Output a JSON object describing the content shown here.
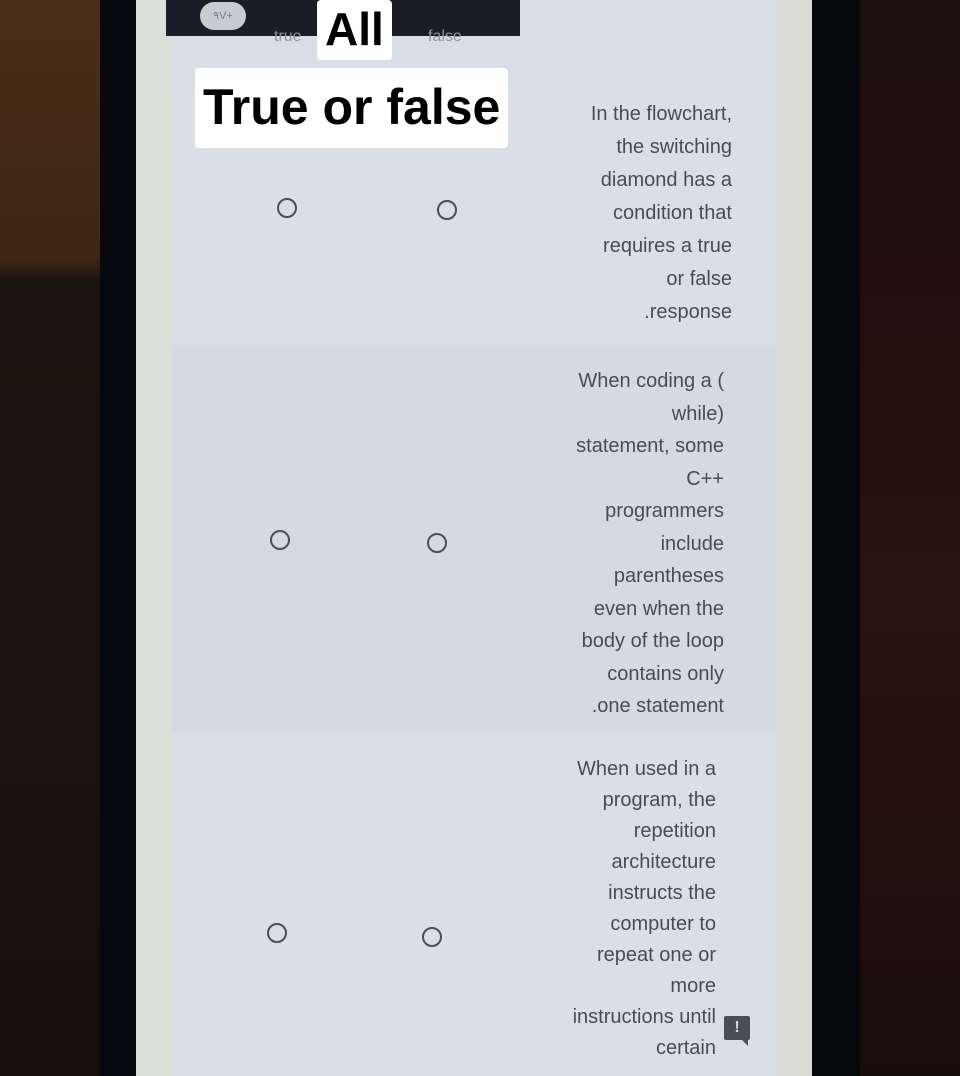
{
  "overlay": {
    "line1": "All",
    "line2": "True or false"
  },
  "header": {
    "badge": "٩V+",
    "columns": [
      "true",
      "false"
    ]
  },
  "questions": [
    {
      "lines": [
        "In the flowchart,",
        "the switching",
        "diamond has a",
        "condition that",
        "requires a true",
        "or false",
        ".response"
      ],
      "options": [
        "true",
        "false"
      ],
      "selected": null
    },
    {
      "lines": [
        "When coding a (",
        "while)",
        "statement, some",
        "C++",
        "programmers",
        "include",
        "parentheses",
        "even when the",
        "body of the loop",
        "contains only",
        ".one statement"
      ],
      "options": [
        "true",
        "false"
      ],
      "selected": null
    },
    {
      "lines": [
        "When used in a",
        "program, the",
        "repetition",
        "architecture",
        "instructs the",
        "computer to",
        "repeat one or",
        "more",
        "instructions until",
        "certain"
      ],
      "options": [
        "true",
        "false"
      ],
      "selected": null
    }
  ],
  "feedback": {
    "icon": "report-problem-icon",
    "glyph": "!"
  }
}
